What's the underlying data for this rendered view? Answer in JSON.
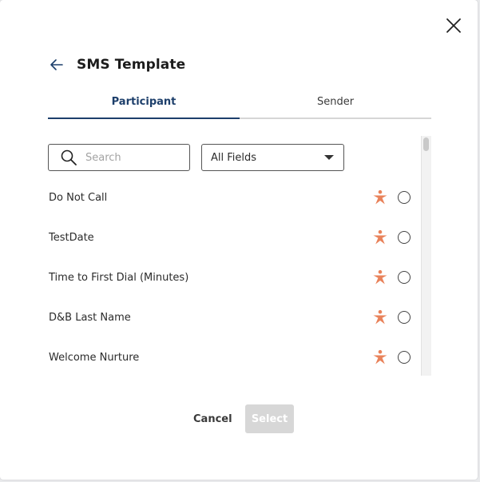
{
  "dialog": {
    "title": "SMS Template"
  },
  "tabs": [
    {
      "label": "Participant",
      "active": true
    },
    {
      "label": "Sender",
      "active": false
    }
  ],
  "search": {
    "placeholder": "Search",
    "value": ""
  },
  "filter": {
    "selected": "All Fields"
  },
  "fields": [
    {
      "label": "Do Not Call",
      "selected": false
    },
    {
      "label": "TestDate",
      "selected": false
    },
    {
      "label": "Time to First Dial (Minutes)",
      "selected": false
    },
    {
      "label": "D&B Last Name",
      "selected": false
    },
    {
      "label": "Welcome Nurture",
      "selected": false
    }
  ],
  "footer": {
    "cancel_label": "Cancel",
    "select_label": "Select"
  },
  "colors": {
    "accent": "#1d3f6b",
    "star": "#e9825a",
    "disabled": "#d7d7d7"
  },
  "icons": {
    "close": "close-icon",
    "back": "arrow-left-icon",
    "search": "search-icon",
    "dropdown": "chevron-down-icon",
    "field_type": "star-person-icon"
  }
}
